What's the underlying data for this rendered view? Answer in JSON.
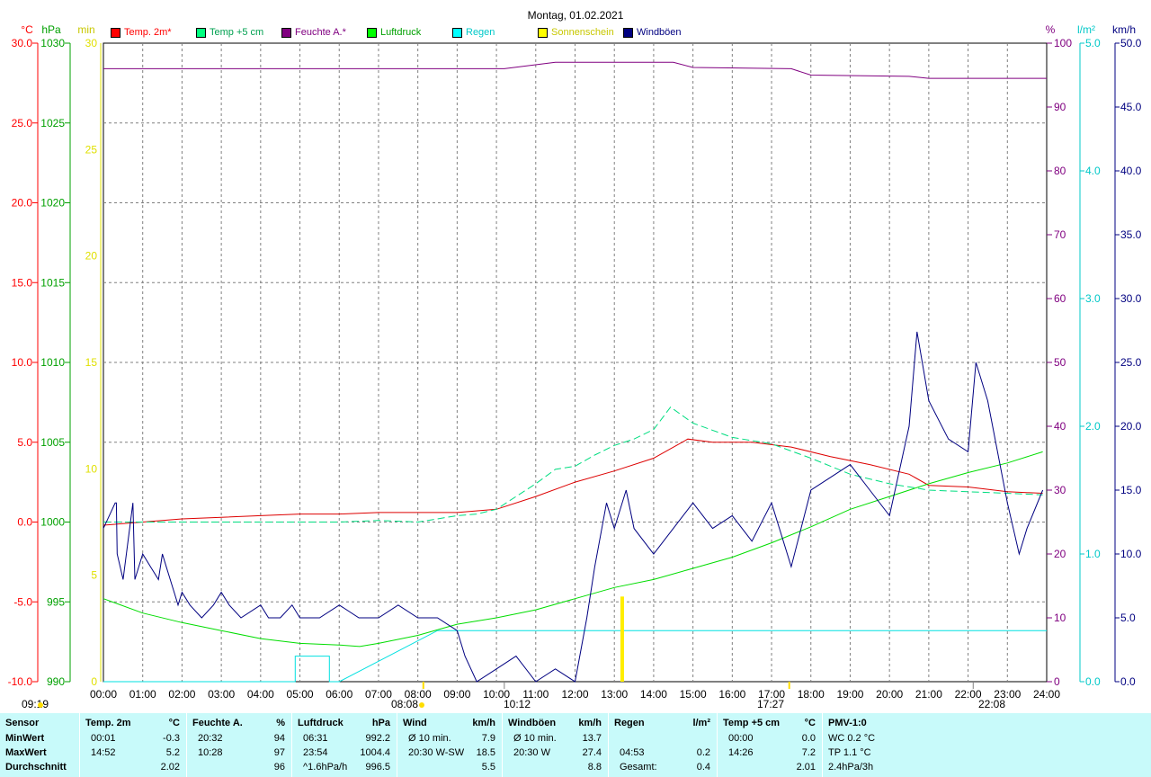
{
  "title": "Montag, 01.02.2021",
  "axes": {
    "left_units": [
      "°C",
      "hPa",
      "min"
    ],
    "right_units": [
      "%",
      "l/m²",
      "km/h"
    ],
    "temp_ticks": [
      "30.0",
      "25.0",
      "20.0",
      "15.0",
      "10.0",
      "5.0",
      "0.0",
      "-5.0",
      "-10.0"
    ],
    "pressure_ticks": [
      "1030",
      "1025",
      "1020",
      "1015",
      "1010",
      "1005",
      "1000",
      "995",
      "990"
    ],
    "sun_ticks": [
      "30",
      "25",
      "20",
      "15",
      "10",
      "5",
      "0"
    ],
    "humidity_ticks": [
      "100",
      "90",
      "80",
      "70",
      "60",
      "50",
      "40",
      "30",
      "20",
      "10",
      "0"
    ],
    "rain_ticks": [
      "5.0",
      "4.0",
      "3.0",
      "2.0",
      "1.0",
      "0.0"
    ],
    "wind_ticks": [
      "50.0",
      "45.0",
      "40.0",
      "35.0",
      "30.0",
      "25.0",
      "20.0",
      "15.0",
      "10.0",
      "5.0",
      "0.0"
    ],
    "time_ticks": [
      "00:00",
      "01:00",
      "02:00",
      "03:00",
      "04:00",
      "05:00",
      "06:00",
      "07:00",
      "08:00",
      "09:00",
      "10:00",
      "11:00",
      "12:00",
      "13:00",
      "14:00",
      "15:00",
      "16:00",
      "17:00",
      "18:00",
      "19:00",
      "20:00",
      "21:00",
      "22:00",
      "23:00",
      "24:00"
    ],
    "colors": {
      "temp": "#ff0000",
      "pressure": "#00a000",
      "sun": "#ffff00",
      "humidity": "#800080",
      "rain": "#00ffff",
      "wind": "#000080"
    }
  },
  "legend": [
    {
      "label": "Temp. 2m*",
      "color": "#ff0000"
    },
    {
      "label": "Temp +5 cm",
      "color": "#00ff7f"
    },
    {
      "label": "Feuchte A.*",
      "color": "#800080"
    },
    {
      "label": "Luftdruck",
      "color": "#00ff00"
    },
    {
      "label": "Regen",
      "color": "#00ffff"
    },
    {
      "label": "Sonnenschein",
      "color": "#ffff00"
    },
    {
      "label": "Windböen",
      "color": "#000080"
    }
  ],
  "events": {
    "moonrise": "09:19",
    "sunrise": "08:08",
    "moon_event": "10:12",
    "sunset": "17:27",
    "moon_set": "22:08"
  },
  "chart_data": {
    "type": "line",
    "x_range": [
      0,
      24
    ],
    "x_unit": "h",
    "series": [
      {
        "name": "Temp. 2m*",
        "unit": "°C",
        "axis": "temp",
        "ylim": [
          -10,
          30
        ],
        "points": [
          [
            0,
            -0.2
          ],
          [
            1,
            0
          ],
          [
            2,
            0.2
          ],
          [
            3,
            0.3
          ],
          [
            4,
            0.4
          ],
          [
            5,
            0.5
          ],
          [
            6,
            0.5
          ],
          [
            7,
            0.6
          ],
          [
            8,
            0.6
          ],
          [
            9,
            0.6
          ],
          [
            10,
            0.8
          ],
          [
            11,
            1.6
          ],
          [
            12,
            2.5
          ],
          [
            13,
            3.2
          ],
          [
            14,
            4
          ],
          [
            14.87,
            5.2
          ],
          [
            15.5,
            5
          ],
          [
            16.5,
            5
          ],
          [
            17.5,
            4.7
          ],
          [
            18.5,
            4.1
          ],
          [
            19.5,
            3.6
          ],
          [
            20.5,
            3
          ],
          [
            21,
            2.3
          ],
          [
            22,
            2.2
          ],
          [
            23,
            1.9
          ],
          [
            23.9,
            1.8
          ]
        ]
      },
      {
        "name": "Temp +5 cm",
        "unit": "°C",
        "axis": "temp",
        "ylim": [
          -10,
          30
        ],
        "points": [
          [
            0,
            0
          ],
          [
            1,
            0
          ],
          [
            2,
            0
          ],
          [
            3,
            0
          ],
          [
            4,
            0
          ],
          [
            5,
            0
          ],
          [
            6,
            0
          ],
          [
            7,
            0.1
          ],
          [
            8,
            0
          ],
          [
            8.5,
            0.2
          ],
          [
            9,
            0.4
          ],
          [
            9.5,
            0.5
          ],
          [
            10,
            0.8
          ],
          [
            10.5,
            1.6
          ],
          [
            11,
            2.4
          ],
          [
            11.5,
            3.3
          ],
          [
            12,
            3.5
          ],
          [
            12.5,
            4.2
          ],
          [
            13,
            4.8
          ],
          [
            13.5,
            5.2
          ],
          [
            14,
            5.8
          ],
          [
            14.43,
            7.2
          ],
          [
            15,
            6.2
          ],
          [
            16,
            5.3
          ],
          [
            17,
            4.9
          ],
          [
            18,
            4
          ],
          [
            19,
            3
          ],
          [
            20,
            2.4
          ],
          [
            21,
            2
          ],
          [
            22,
            1.9
          ],
          [
            23,
            1.8
          ],
          [
            23.9,
            1.7
          ]
        ]
      },
      {
        "name": "Feuchte A.*",
        "unit": "%",
        "axis": "humidity",
        "ylim": [
          0,
          100
        ],
        "points": [
          [
            0,
            96
          ],
          [
            10.2,
            96
          ],
          [
            11.5,
            97
          ],
          [
            14.5,
            97
          ],
          [
            15,
            96.2
          ],
          [
            17.5,
            96
          ],
          [
            18,
            95
          ],
          [
            20.5,
            94.8
          ],
          [
            21,
            94.5
          ],
          [
            24,
            94.5
          ]
        ]
      },
      {
        "name": "Luftdruck",
        "unit": "hPa",
        "axis": "pressure",
        "ylim": [
          990,
          1030
        ],
        "points": [
          [
            0,
            995.2
          ],
          [
            1,
            994.3
          ],
          [
            2,
            993.7
          ],
          [
            3,
            993.2
          ],
          [
            4,
            992.7
          ],
          [
            5,
            992.4
          ],
          [
            6,
            992.3
          ],
          [
            6.52,
            992.2
          ],
          [
            7,
            992.4
          ],
          [
            8,
            992.9
          ],
          [
            9,
            993.6
          ],
          [
            10,
            994
          ],
          [
            11,
            994.5
          ],
          [
            12,
            995.2
          ],
          [
            13,
            995.9
          ],
          [
            14,
            996.4
          ],
          [
            15,
            997.1
          ],
          [
            16,
            997.8
          ],
          [
            17,
            998.7
          ],
          [
            18,
            999.7
          ],
          [
            19,
            1000.8
          ],
          [
            20,
            1001.6
          ],
          [
            21,
            1002.4
          ],
          [
            22,
            1003.1
          ],
          [
            23,
            1003.7
          ],
          [
            23.9,
            1004.4
          ]
        ]
      },
      {
        "name": "Regen",
        "unit": "l/m²",
        "axis": "rain",
        "ylim": [
          0,
          5
        ],
        "points": [
          [
            0,
            0
          ],
          [
            4.88,
            0
          ],
          [
            4.88,
            0.2
          ],
          [
            5.75,
            0.2
          ],
          [
            5.75,
            0
          ],
          [
            6.0,
            0
          ],
          [
            8.5,
            0.4
          ],
          [
            24,
            0.4
          ]
        ]
      },
      {
        "name": "Sonnenschein",
        "unit": "min",
        "axis": "sun",
        "ylim": [
          0,
          30
        ],
        "bars": [
          [
            13.2,
            4
          ]
        ]
      },
      {
        "name": "Windböen",
        "unit": "km/h",
        "axis": "wind",
        "ylim": [
          0,
          50
        ],
        "points": [
          [
            0,
            12
          ],
          [
            0.3,
            14
          ],
          [
            0.33,
            14
          ],
          [
            0.35,
            10
          ],
          [
            0.5,
            8
          ],
          [
            0.75,
            14
          ],
          [
            0.8,
            8
          ],
          [
            1,
            10
          ],
          [
            1.2,
            9
          ],
          [
            1.4,
            8
          ],
          [
            1.5,
            10
          ],
          [
            1.6,
            9
          ],
          [
            1.8,
            7
          ],
          [
            1.9,
            6
          ],
          [
            2.0,
            7
          ],
          [
            2.2,
            6
          ],
          [
            2.5,
            5
          ],
          [
            2.8,
            6
          ],
          [
            3,
            7
          ],
          [
            3.2,
            6
          ],
          [
            3.5,
            5
          ],
          [
            4,
            6
          ],
          [
            4.2,
            5
          ],
          [
            4.5,
            5
          ],
          [
            4.8,
            6
          ],
          [
            5,
            5
          ],
          [
            5.5,
            5
          ],
          [
            6,
            6
          ],
          [
            6.5,
            5
          ],
          [
            7,
            5
          ],
          [
            7.5,
            6
          ],
          [
            8,
            5
          ],
          [
            8.5,
            5
          ],
          [
            9,
            4
          ],
          [
            9.2,
            2
          ],
          [
            9.5,
            0
          ],
          [
            10,
            1
          ],
          [
            10.5,
            2
          ],
          [
            11,
            0
          ],
          [
            11.5,
            1
          ],
          [
            12,
            0
          ],
          [
            12.3,
            5
          ],
          [
            12.5,
            9
          ],
          [
            12.8,
            14
          ],
          [
            13.0,
            12
          ],
          [
            13.3,
            15
          ],
          [
            13.5,
            12
          ],
          [
            14,
            10
          ],
          [
            14.5,
            12
          ],
          [
            15,
            14
          ],
          [
            15.5,
            12
          ],
          [
            16,
            13
          ],
          [
            16.5,
            11
          ],
          [
            17,
            14
          ],
          [
            17.5,
            9
          ],
          [
            18,
            15
          ],
          [
            18.5,
            16
          ],
          [
            19,
            17
          ],
          [
            19.5,
            15
          ],
          [
            20,
            13
          ],
          [
            20.5,
            20
          ],
          [
            20.7,
            27.4
          ],
          [
            21,
            22
          ],
          [
            21.5,
            19
          ],
          [
            22,
            18
          ],
          [
            22.2,
            25
          ],
          [
            22.5,
            22
          ],
          [
            23,
            14
          ],
          [
            23.3,
            10
          ],
          [
            23.5,
            12
          ],
          [
            23.9,
            15
          ]
        ]
      }
    ]
  },
  "stats": {
    "columns": [
      {
        "header": "Sensor",
        "unit": "",
        "rows": [
          "MinWert",
          "MaxWert",
          "Durchschnitt"
        ]
      },
      {
        "header": "Temp. 2m",
        "unit": "°C",
        "rows": [
          [
            "00:01",
            "-0.3"
          ],
          [
            "14:52",
            "5.2"
          ],
          [
            "",
            "2.02"
          ]
        ]
      },
      {
        "header": "Feuchte A.",
        "unit": "%",
        "rows": [
          [
            "20:32",
            "94"
          ],
          [
            "10:28",
            "97"
          ],
          [
            "",
            "96"
          ]
        ]
      },
      {
        "header": "Luftdruck",
        "unit": "hPa",
        "rows": [
          [
            "06:31",
            "992.2"
          ],
          [
            "23:54",
            "1004.4"
          ],
          [
            "^1.6hPa/h",
            "996.5"
          ]
        ]
      },
      {
        "header": "Wind",
        "unit": "km/h",
        "rows": [
          [
            "Ø 10 min.",
            "7.9"
          ],
          [
            "20:30 W-SW",
            "18.5"
          ],
          [
            "",
            "5.5"
          ]
        ]
      },
      {
        "header": "Windböen",
        "unit": "km/h",
        "rows": [
          [
            "Ø 10 min.",
            "13.7"
          ],
          [
            "20:30 W",
            "27.4"
          ],
          [
            "",
            "8.8"
          ]
        ]
      },
      {
        "header": "Regen",
        "unit": "l/m²",
        "rows": [
          [
            "",
            ""
          ],
          [
            "04:53",
            "0.2"
          ],
          [
            "Gesamt:",
            "0.4"
          ]
        ]
      },
      {
        "header": "Temp +5 cm",
        "unit": "°C",
        "rows": [
          [
            "00:00",
            "0.0"
          ],
          [
            "14:26",
            "7.2"
          ],
          [
            "",
            "2.01"
          ]
        ]
      },
      {
        "header": "PMV-1:0",
        "unit": "",
        "rows": [
          "WC 0.2 °C",
          "TP 1.1 °C",
          "2.4hPa/3h"
        ]
      }
    ]
  }
}
